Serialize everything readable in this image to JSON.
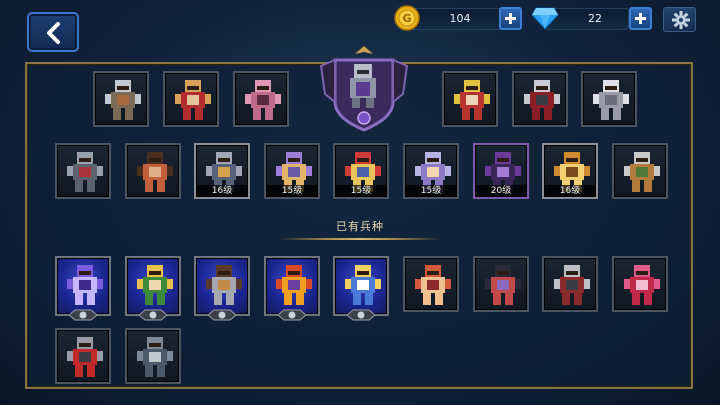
{
  "resources": {
    "gold": {
      "value": "104",
      "icon": "gold-coin-icon"
    },
    "gems": {
      "value": "22",
      "icon": "diamond-icon"
    }
  },
  "section": {
    "owned_title": "已有兵种"
  },
  "heroes_top_row": [
    {
      "level": ""
    },
    {
      "level": ""
    },
    {
      "level": ""
    },
    {
      "level": ""
    },
    {
      "level": ""
    },
    {
      "level": ""
    }
  ],
  "heroes_second_row": [
    {
      "level": ""
    },
    {
      "level": ""
    },
    {
      "level": "16级"
    },
    {
      "level": "15级"
    },
    {
      "level": "15级"
    },
    {
      "level": "15级"
    },
    {
      "level": "20级"
    },
    {
      "level": "16级"
    },
    {
      "level": ""
    }
  ],
  "owned_units": [
    {
      "level": ""
    },
    {
      "level": ""
    },
    {
      "level": ""
    },
    {
      "level": ""
    },
    {
      "level": ""
    },
    {
      "level": ""
    },
    {
      "level": ""
    },
    {
      "level": ""
    },
    {
      "level": ""
    },
    {
      "level": ""
    },
    {
      "level": ""
    }
  ],
  "colors": {
    "panel_border": "#8a7443",
    "accent_blue": "#3b78c8",
    "featured_purple": "#5b3e8c"
  }
}
